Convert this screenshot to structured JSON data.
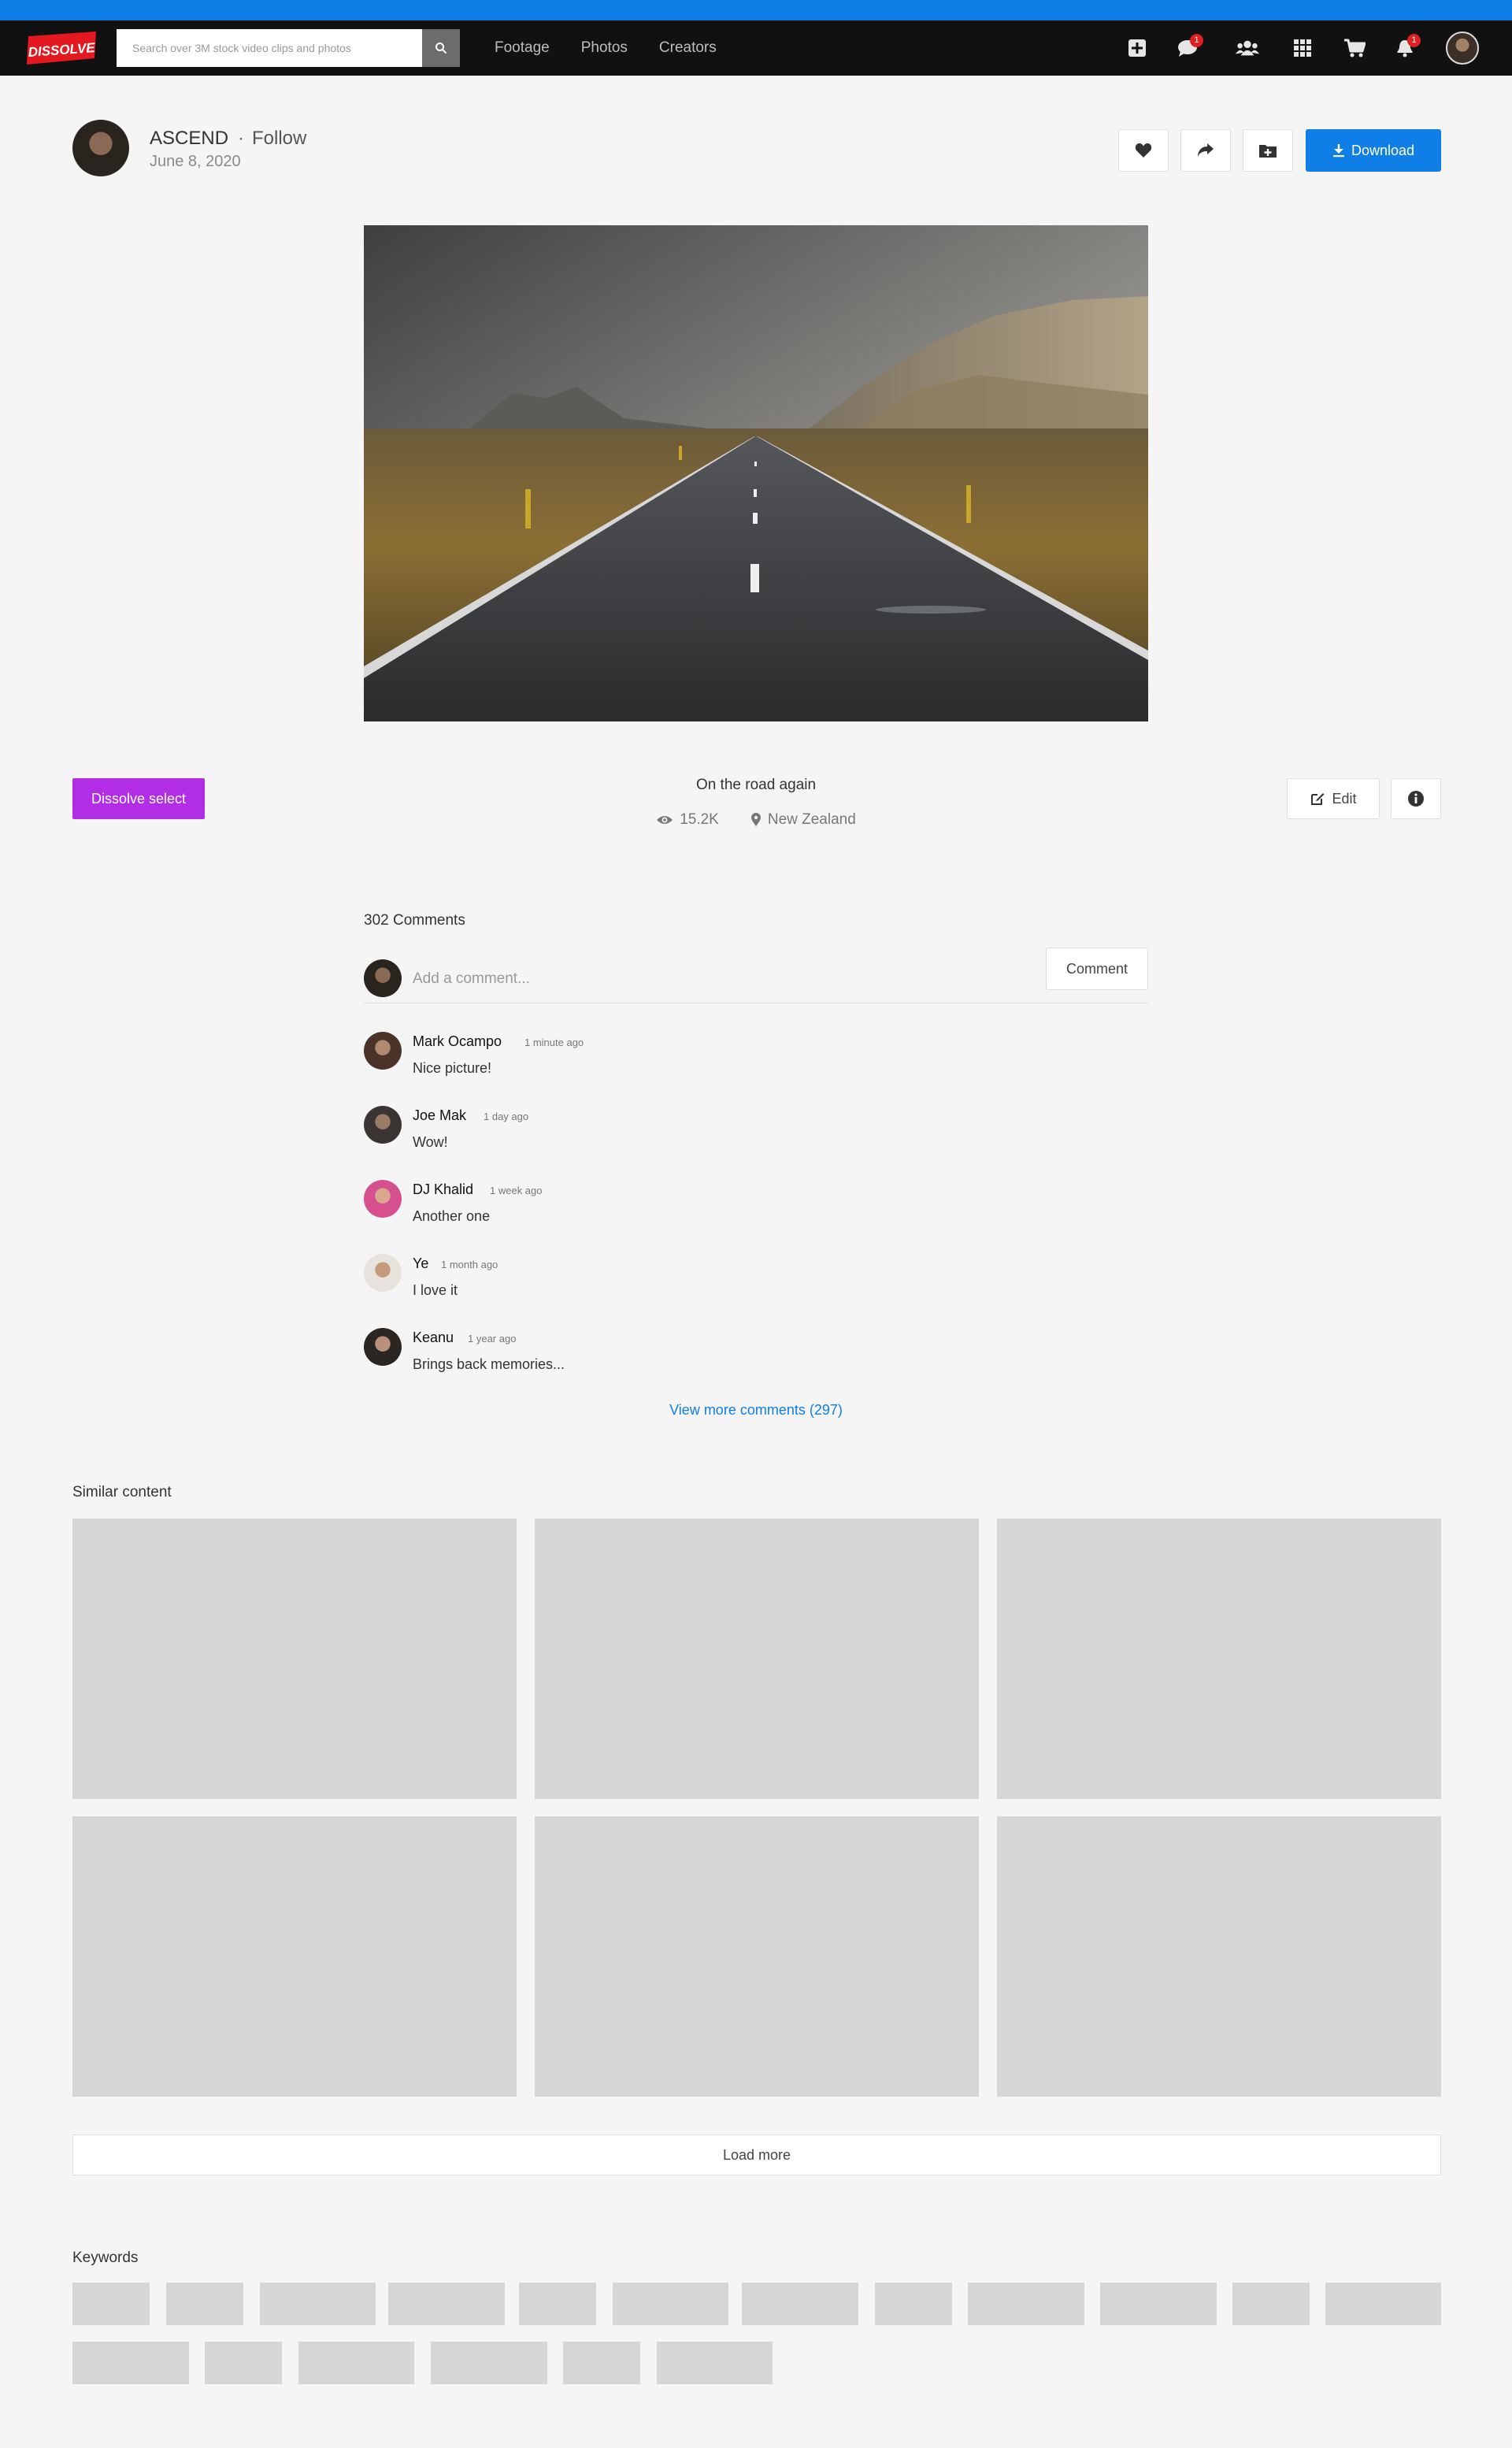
{
  "brand": {
    "logo_text": "DISSOLVE",
    "accent_color": "#0f7ee6",
    "select_color": "#b22ee6",
    "badge_color": "#e02020"
  },
  "search": {
    "placeholder": "Search over 3M stock video clips and photos",
    "icon": "search-icon"
  },
  "nav": {
    "links": [
      "Footage",
      "Photos",
      "Creators"
    ],
    "icons": [
      "plus-square-icon",
      "chat-icon",
      "users-icon",
      "grid-icon",
      "cart-icon",
      "bell-icon"
    ],
    "chat_badge": "1",
    "bell_badge": "1"
  },
  "author": {
    "name": "ASCEND",
    "separator": "·",
    "follow_label": "Follow",
    "date": "June 8, 2020"
  },
  "actions": {
    "like_icon": "heart-icon",
    "share_icon": "share-icon",
    "collect_icon": "folder-plus-icon",
    "download_label": "Download"
  },
  "photo": {
    "title": "On the road again",
    "views": "15.2K",
    "location": "New Zealand"
  },
  "buttons": {
    "select_label": "Dissolve select",
    "edit_label": "Edit",
    "info_icon": "info-icon"
  },
  "comments": {
    "count_label": "302 Comments",
    "input_placeholder": "Add a comment...",
    "submit_label": "Comment",
    "items": [
      {
        "name": "Mark Ocampo",
        "time": "1 minute ago",
        "text": "Nice picture!"
      },
      {
        "name": "Joe Mak",
        "time": "1 day ago",
        "text": "Wow!"
      },
      {
        "name": "DJ Khalid",
        "time": "1 week ago",
        "text": "Another one"
      },
      {
        "name": "Ye",
        "time": "1 month ago",
        "text": "I love it"
      },
      {
        "name": "Keanu",
        "time": "1 year ago",
        "text": "Brings back memories..."
      }
    ],
    "view_more_label": "View more comments (297)"
  },
  "similar": {
    "title": "Similar content",
    "load_more_label": "Load more"
  },
  "keywords": {
    "title": "Keywords"
  }
}
